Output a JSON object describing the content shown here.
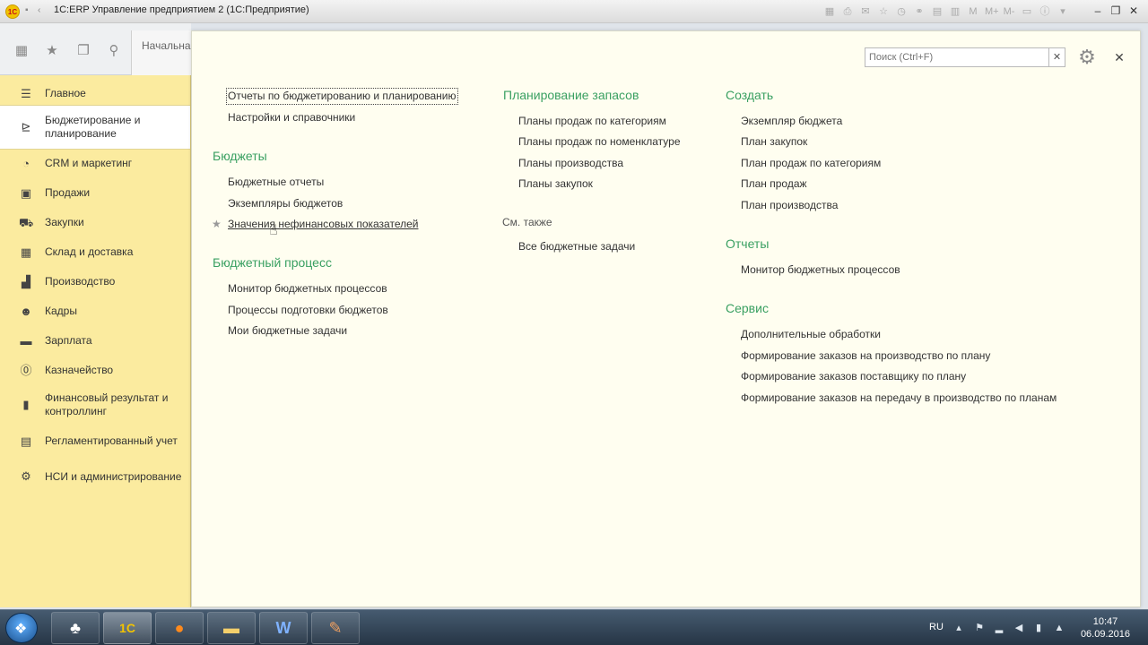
{
  "window": {
    "title": "1С:ERP Управление предприятием 2  (1С:Предприятие)",
    "logo_text": "1С"
  },
  "toolbar": {
    "start_tab": "Начальна"
  },
  "sidebar": {
    "items": [
      {
        "label": "Главное",
        "icon": "menu-icon"
      },
      {
        "label": "Бюджетирование и планирование",
        "icon": "budget-icon"
      },
      {
        "label": "CRM и маркетинг",
        "icon": "crm-icon"
      },
      {
        "label": "Продажи",
        "icon": "sales-icon"
      },
      {
        "label": "Закупки",
        "icon": "cart-icon"
      },
      {
        "label": "Склад и доставка",
        "icon": "warehouse-icon"
      },
      {
        "label": "Производство",
        "icon": "factory-icon"
      },
      {
        "label": "Кадры",
        "icon": "staff-icon"
      },
      {
        "label": "Зарплата",
        "icon": "salary-icon"
      },
      {
        "label": "Казначейство",
        "icon": "treasury-icon"
      },
      {
        "label": "Финансовый результат и контроллинг",
        "icon": "chart-icon"
      },
      {
        "label": "Регламентированный учет",
        "icon": "ledger-icon"
      },
      {
        "label": "НСИ и администрирование",
        "icon": "gear-icon"
      }
    ]
  },
  "panel": {
    "search_placeholder": "Поиск (Ctrl+F)",
    "col1": {
      "top_links": [
        "Отчеты по бюджетированию и планированию",
        "Настройки и справочники"
      ],
      "budgets_title": "Бюджеты",
      "budgets_links": [
        "Бюджетные отчеты",
        "Экземпляры бюджетов",
        "Значения нефинансовых показателей"
      ],
      "process_title": "Бюджетный процесс",
      "process_links": [
        "Монитор бюджетных процессов",
        "Процессы подготовки бюджетов",
        "Мои бюджетные задачи"
      ]
    },
    "col2": {
      "planning_title": "Планирование запасов",
      "planning_links": [
        "Планы продаж по категориям",
        "Планы продаж по номенклатуре",
        "Планы производства",
        "Планы закупок"
      ],
      "see_also_title": "См. также",
      "see_also_links": [
        "Все бюджетные задачи"
      ]
    },
    "col3": {
      "create_title": "Создать",
      "create_links": [
        "Экземпляр бюджета",
        "План закупок",
        "План продаж по категориям",
        "План продаж",
        "План производства"
      ],
      "reports_title": "Отчеты",
      "reports_links": [
        "Монитор бюджетных процессов"
      ],
      "service_title": "Сервис",
      "service_links": [
        "Дополнительные обработки",
        "Формирование заказов на производство по плану",
        "Формирование заказов поставщику по плану",
        "Формирование заказов на передачу в производство по планам"
      ]
    }
  },
  "taskbar": {
    "language": "RU",
    "time": "10:47",
    "date": "06.09.2016"
  }
}
